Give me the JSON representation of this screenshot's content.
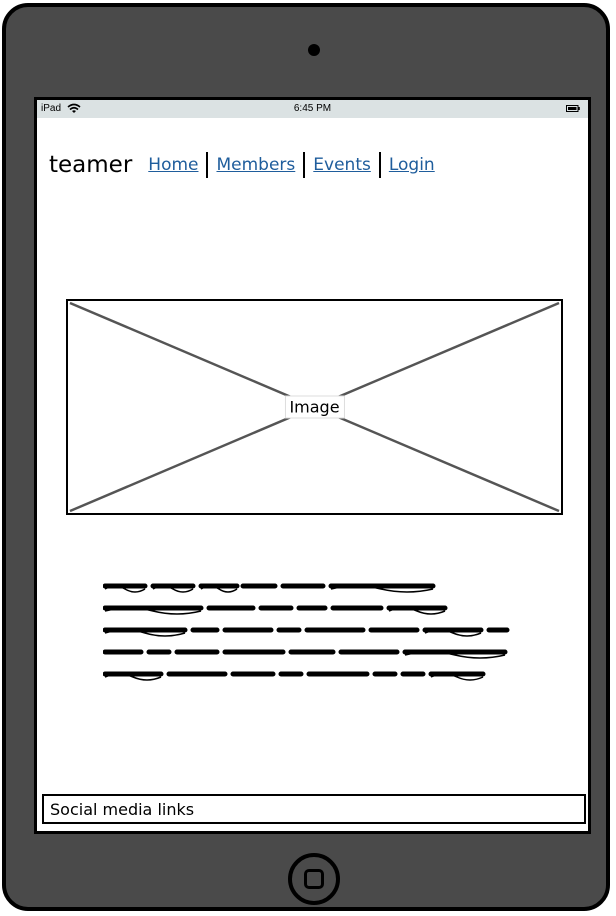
{
  "status_bar": {
    "device": "iPad",
    "time": "6:45 PM"
  },
  "header": {
    "logo": "teamer",
    "nav": [
      {
        "label": "Home"
      },
      {
        "label": "Members"
      },
      {
        "label": "Events"
      },
      {
        "label": "Login"
      }
    ]
  },
  "hero": {
    "image_label": "Image"
  },
  "footer": {
    "label": "Social media links"
  },
  "colors": {
    "link": "#1f5d9c",
    "device_frame": "#4a4a4a",
    "status_bar": "#dbe2e3"
  },
  "icons": [
    "wifi-icon",
    "battery-icon",
    "home-button-icon",
    "camera-icon"
  ]
}
